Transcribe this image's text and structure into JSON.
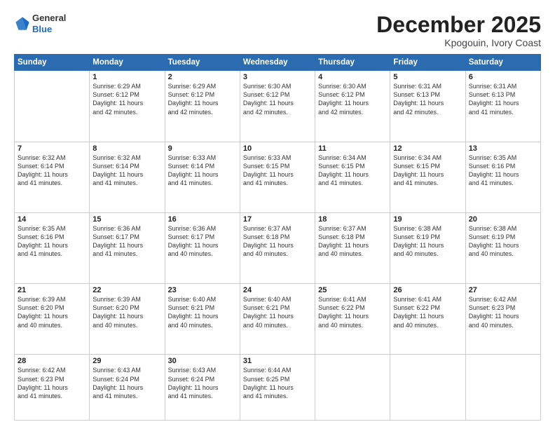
{
  "header": {
    "logo_line1": "General",
    "logo_line2": "Blue",
    "month": "December 2025",
    "location": "Kpogouin, Ivory Coast"
  },
  "weekdays": [
    "Sunday",
    "Monday",
    "Tuesday",
    "Wednesday",
    "Thursday",
    "Friday",
    "Saturday"
  ],
  "weeks": [
    [
      {
        "day": "",
        "info": ""
      },
      {
        "day": "1",
        "info": "Sunrise: 6:29 AM\nSunset: 6:12 PM\nDaylight: 11 hours\nand 42 minutes."
      },
      {
        "day": "2",
        "info": "Sunrise: 6:29 AM\nSunset: 6:12 PM\nDaylight: 11 hours\nand 42 minutes."
      },
      {
        "day": "3",
        "info": "Sunrise: 6:30 AM\nSunset: 6:12 PM\nDaylight: 11 hours\nand 42 minutes."
      },
      {
        "day": "4",
        "info": "Sunrise: 6:30 AM\nSunset: 6:12 PM\nDaylight: 11 hours\nand 42 minutes."
      },
      {
        "day": "5",
        "info": "Sunrise: 6:31 AM\nSunset: 6:13 PM\nDaylight: 11 hours\nand 42 minutes."
      },
      {
        "day": "6",
        "info": "Sunrise: 6:31 AM\nSunset: 6:13 PM\nDaylight: 11 hours\nand 41 minutes."
      }
    ],
    [
      {
        "day": "7",
        "info": "Sunrise: 6:32 AM\nSunset: 6:14 PM\nDaylight: 11 hours\nand 41 minutes."
      },
      {
        "day": "8",
        "info": "Sunrise: 6:32 AM\nSunset: 6:14 PM\nDaylight: 11 hours\nand 41 minutes."
      },
      {
        "day": "9",
        "info": "Sunrise: 6:33 AM\nSunset: 6:14 PM\nDaylight: 11 hours\nand 41 minutes."
      },
      {
        "day": "10",
        "info": "Sunrise: 6:33 AM\nSunset: 6:15 PM\nDaylight: 11 hours\nand 41 minutes."
      },
      {
        "day": "11",
        "info": "Sunrise: 6:34 AM\nSunset: 6:15 PM\nDaylight: 11 hours\nand 41 minutes."
      },
      {
        "day": "12",
        "info": "Sunrise: 6:34 AM\nSunset: 6:15 PM\nDaylight: 11 hours\nand 41 minutes."
      },
      {
        "day": "13",
        "info": "Sunrise: 6:35 AM\nSunset: 6:16 PM\nDaylight: 11 hours\nand 41 minutes."
      }
    ],
    [
      {
        "day": "14",
        "info": "Sunrise: 6:35 AM\nSunset: 6:16 PM\nDaylight: 11 hours\nand 41 minutes."
      },
      {
        "day": "15",
        "info": "Sunrise: 6:36 AM\nSunset: 6:17 PM\nDaylight: 11 hours\nand 41 minutes."
      },
      {
        "day": "16",
        "info": "Sunrise: 6:36 AM\nSunset: 6:17 PM\nDaylight: 11 hours\nand 40 minutes."
      },
      {
        "day": "17",
        "info": "Sunrise: 6:37 AM\nSunset: 6:18 PM\nDaylight: 11 hours\nand 40 minutes."
      },
      {
        "day": "18",
        "info": "Sunrise: 6:37 AM\nSunset: 6:18 PM\nDaylight: 11 hours\nand 40 minutes."
      },
      {
        "day": "19",
        "info": "Sunrise: 6:38 AM\nSunset: 6:19 PM\nDaylight: 11 hours\nand 40 minutes."
      },
      {
        "day": "20",
        "info": "Sunrise: 6:38 AM\nSunset: 6:19 PM\nDaylight: 11 hours\nand 40 minutes."
      }
    ],
    [
      {
        "day": "21",
        "info": "Sunrise: 6:39 AM\nSunset: 6:20 PM\nDaylight: 11 hours\nand 40 minutes."
      },
      {
        "day": "22",
        "info": "Sunrise: 6:39 AM\nSunset: 6:20 PM\nDaylight: 11 hours\nand 40 minutes."
      },
      {
        "day": "23",
        "info": "Sunrise: 6:40 AM\nSunset: 6:21 PM\nDaylight: 11 hours\nand 40 minutes."
      },
      {
        "day": "24",
        "info": "Sunrise: 6:40 AM\nSunset: 6:21 PM\nDaylight: 11 hours\nand 40 minutes."
      },
      {
        "day": "25",
        "info": "Sunrise: 6:41 AM\nSunset: 6:22 PM\nDaylight: 11 hours\nand 40 minutes."
      },
      {
        "day": "26",
        "info": "Sunrise: 6:41 AM\nSunset: 6:22 PM\nDaylight: 11 hours\nand 40 minutes."
      },
      {
        "day": "27",
        "info": "Sunrise: 6:42 AM\nSunset: 6:23 PM\nDaylight: 11 hours\nand 40 minutes."
      }
    ],
    [
      {
        "day": "28",
        "info": "Sunrise: 6:42 AM\nSunset: 6:23 PM\nDaylight: 11 hours\nand 41 minutes."
      },
      {
        "day": "29",
        "info": "Sunrise: 6:43 AM\nSunset: 6:24 PM\nDaylight: 11 hours\nand 41 minutes."
      },
      {
        "day": "30",
        "info": "Sunrise: 6:43 AM\nSunset: 6:24 PM\nDaylight: 11 hours\nand 41 minutes."
      },
      {
        "day": "31",
        "info": "Sunrise: 6:44 AM\nSunset: 6:25 PM\nDaylight: 11 hours\nand 41 minutes."
      },
      {
        "day": "",
        "info": ""
      },
      {
        "day": "",
        "info": ""
      },
      {
        "day": "",
        "info": ""
      }
    ]
  ]
}
